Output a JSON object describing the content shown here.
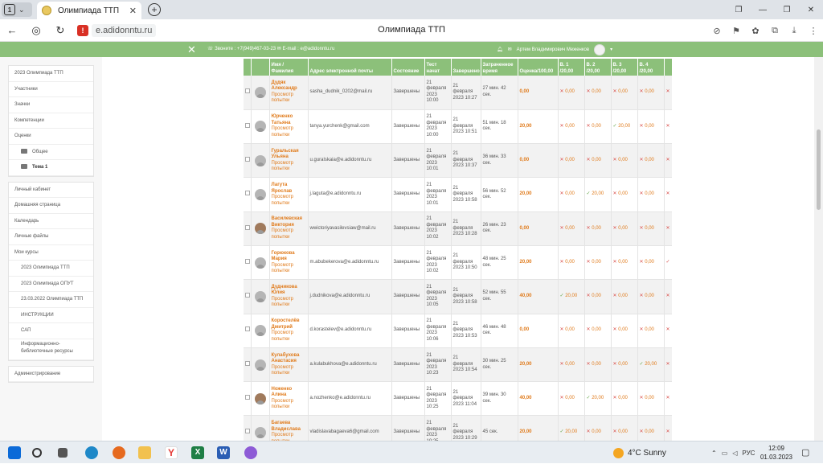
{
  "browser": {
    "tab_counter": "1",
    "tab_title": "Олимпиада ТТП",
    "tab_close": "✕",
    "new_tab": "+",
    "url": "e.adidonntu.ru",
    "page_title": "Олимпиада ТТП",
    "url_warning": "!"
  },
  "moodle": {
    "contacts": "☏ Звоните : +7(949)467-03-23  ✉ E-mail : e@adidonntu.ru",
    "user_name": "Артем Владимирович Меженков",
    "close": "✕"
  },
  "sidebar": {
    "block1": [
      "2023 Олимпиада ТТП",
      "Участники",
      "Значки",
      "Компетенции",
      "Оценки"
    ],
    "folder1": "Общее",
    "folder2": "Тема 1",
    "block2": [
      "Личный кабинет",
      "Домашняя страница",
      "Календарь",
      "Личные файлы",
      "Мои курсы"
    ],
    "courses": [
      "2023 Олимпиада ТТП",
      "2023 Олимпиада ОПУТ",
      "23.03.2022 Олимпиада ТТП",
      "ИНСТРУКЦИИ",
      "САП",
      "Информационно-библиотечные ресурсы"
    ],
    "admin": "Администрирование"
  },
  "table": {
    "headers": {
      "name": "Имя / Фамилия",
      "email": "Адрес электронной почты",
      "state": "Состояние",
      "started": "Тест начат",
      "finished": "Завершено",
      "spent": "Затраченное время",
      "grade": "Оценка/100,00",
      "q1": "В. 1 /20,00",
      "q2": "В. 2 /20,00",
      "q3": "В. 3 /20,00",
      "q4": "В. 4 /20,00"
    },
    "review_label": "Просмотр попытки",
    "rows": [
      {
        "name": "Дудяк Александр",
        "email": "sasha_dudnik_0202@mail.ru",
        "state": "Завершены",
        "started": "21 февраля 2023 10:00",
        "finished": "21 февраля 2023 10:27",
        "spent": "27 мин. 42 сек.",
        "grade": "0,00",
        "q": [
          [
            "x",
            "0,00"
          ],
          [
            "x",
            "0,00"
          ],
          [
            "x",
            "0,00"
          ],
          [
            "x",
            "0,00"
          ]
        ]
      },
      {
        "name": "Юрченко Татьяна",
        "email": "tanya.yurchenk@gmail.com",
        "state": "Завершены",
        "started": "21 февраля 2023 10:00",
        "finished": "21 февраля 2023 10:51",
        "spent": "51 мин. 18 сек.",
        "grade": "20,00",
        "q": [
          [
            "x",
            "0,00"
          ],
          [
            "x",
            "0,00"
          ],
          [
            "ok",
            "20,00"
          ],
          [
            "x",
            "0,00"
          ]
        ]
      },
      {
        "name": "Гуральская Ульяна",
        "email": "u.guralskaia@e.adidonntu.ru",
        "state": "Завершены",
        "started": "21 февраля 2023 10:01",
        "finished": "21 февраля 2023 10:37",
        "spent": "36 мин. 33 сек.",
        "grade": "0,00",
        "q": [
          [
            "x",
            "0,00"
          ],
          [
            "x",
            "0,00"
          ],
          [
            "x",
            "0,00"
          ],
          [
            "x",
            "0,00"
          ]
        ]
      },
      {
        "name": "Лагута Ярослав",
        "email": "j.laguta@e.adidonntu.ru",
        "state": "Завершены",
        "started": "21 февраля 2023 10:01",
        "finished": "21 февраля 2023 10:58",
        "spent": "56 мин. 52 сек.",
        "grade": "20,00",
        "q": [
          [
            "x",
            "0,00"
          ],
          [
            "ok",
            "20,00"
          ],
          [
            "x",
            "0,00"
          ],
          [
            "x",
            "0,00"
          ]
        ]
      },
      {
        "name": "Василевская Виктория",
        "email": "wwictoriyavasilevsiaw@mail.ru",
        "state": "Завершены",
        "started": "21 февраля 2023 10:02",
        "finished": "21 февраля 2023 10:28",
        "spent": "26 мин. 23 сек.",
        "grade": "0,00",
        "q": [
          [
            "x",
            "0,00"
          ],
          [
            "x",
            "0,00"
          ],
          [
            "x",
            "0,00"
          ],
          [
            "x",
            "0,00"
          ]
        ],
        "photo": true
      },
      {
        "name": "Горюкова Мария",
        "email": "m.abubekerova@e.adidonntu.ru",
        "state": "Завершены",
        "started": "21 февраля 2023 10:02",
        "finished": "21 февраля 2023 10:50",
        "spent": "48 мин. 25 сек.",
        "grade": "20,00",
        "q": [
          [
            "x",
            "0,00"
          ],
          [
            "x",
            "0,00"
          ],
          [
            "x",
            "0,00"
          ],
          [
            "x",
            "0,00"
          ]
        ]
      },
      {
        "name": "Дудникова Юлия",
        "email": "j.dudnikova@e.adidonntu.ru",
        "state": "Завершены",
        "started": "21 февраля 2023 10:05",
        "finished": "21 февраля 2023 10:58",
        "spent": "52 мин. 55 сек.",
        "grade": "40,00",
        "q": [
          [
            "ok",
            "20,00"
          ],
          [
            "x",
            "0,00"
          ],
          [
            "x",
            "0,00"
          ],
          [
            "x",
            "0,00"
          ]
        ]
      },
      {
        "name": "Коростелёв Дмитрий",
        "email": "d.korastelev@e.adidonntu.ru",
        "state": "Завершены",
        "started": "21 февраля 2023 10:06",
        "finished": "21 февраля 2023 10:53",
        "spent": "46 мин. 48 сек.",
        "grade": "0,00",
        "q": [
          [
            "x",
            "0,00"
          ],
          [
            "x",
            "0,00"
          ],
          [
            "x",
            "0,00"
          ],
          [
            "x",
            "0,00"
          ]
        ]
      },
      {
        "name": "Кулабухова Анастасия",
        "email": "a.kulabukhova@e.adidonntu.ru",
        "state": "Завершены",
        "started": "21 февраля 2023 10:23",
        "finished": "21 февраля 2023 10:54",
        "spent": "30 мин. 25 сек.",
        "grade": "20,00",
        "q": [
          [
            "x",
            "0,00"
          ],
          [
            "x",
            "0,00"
          ],
          [
            "x",
            "0,00"
          ],
          [
            "ok",
            "20,00"
          ]
        ]
      },
      {
        "name": "Ноженко Алина",
        "email": "a.nozhenko@e.adidonntu.ru",
        "state": "Завершены",
        "started": "21 февраля 2023 10:25",
        "finished": "21 февраля 2023 11:04",
        "spent": "39 мин. 30 сек.",
        "grade": "40,00",
        "q": [
          [
            "x",
            "0,00"
          ],
          [
            "ok",
            "20,00"
          ],
          [
            "x",
            "0,00"
          ],
          [
            "x",
            "0,00"
          ]
        ],
        "photo": true
      },
      {
        "name": "Багаева Владислава",
        "email": "vladislavabagaeva6@gmail.com",
        "state": "Завершены",
        "started": "21 февраля 2023 10:25",
        "finished": "21 февраля 2023 10:29",
        "spent": "45 сек.",
        "grade": "20,00",
        "q": [
          [
            "ok",
            "20,00"
          ],
          [
            "x",
            "0,00"
          ],
          [
            "x",
            "0,00"
          ],
          [
            "x",
            "0,00"
          ]
        ]
      }
    ]
  },
  "taskbar": {
    "weather": "4°C  Sunny",
    "lang": "РУС",
    "time": "12:09",
    "date": "01.03.2023"
  }
}
